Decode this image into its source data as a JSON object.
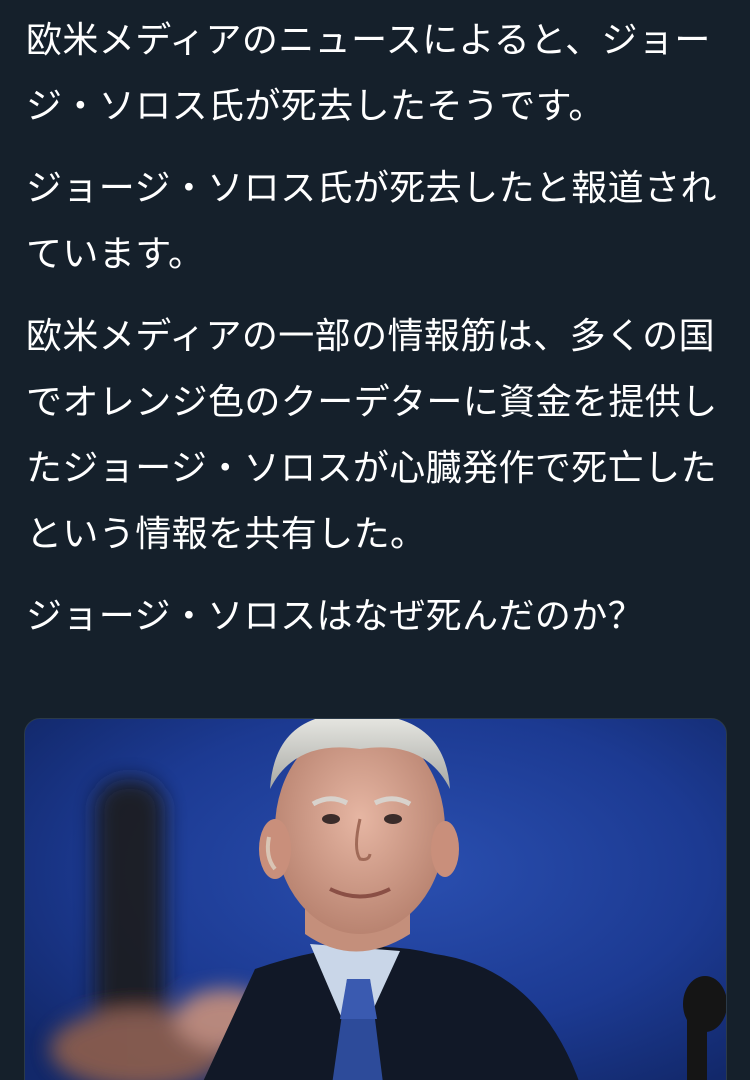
{
  "tweet": {
    "paragraphs": [
      "欧米メディアのニュースによると、ジョージ・ソロス氏が死去したそうです。",
      "ジョージ・ソロス氏が死去したと報道されています。",
      "欧米メディアの一部の情報筋は、多くの国でオレンジ色のクーデターに資金を提供したジョージ・ソロスが心臓発作で死亡したという情報を共有した。",
      "ジョージ・ソロスはなぜ死んだのか？"
    ]
  },
  "media": {
    "alt": "",
    "background_color": "#1b3a8c"
  }
}
